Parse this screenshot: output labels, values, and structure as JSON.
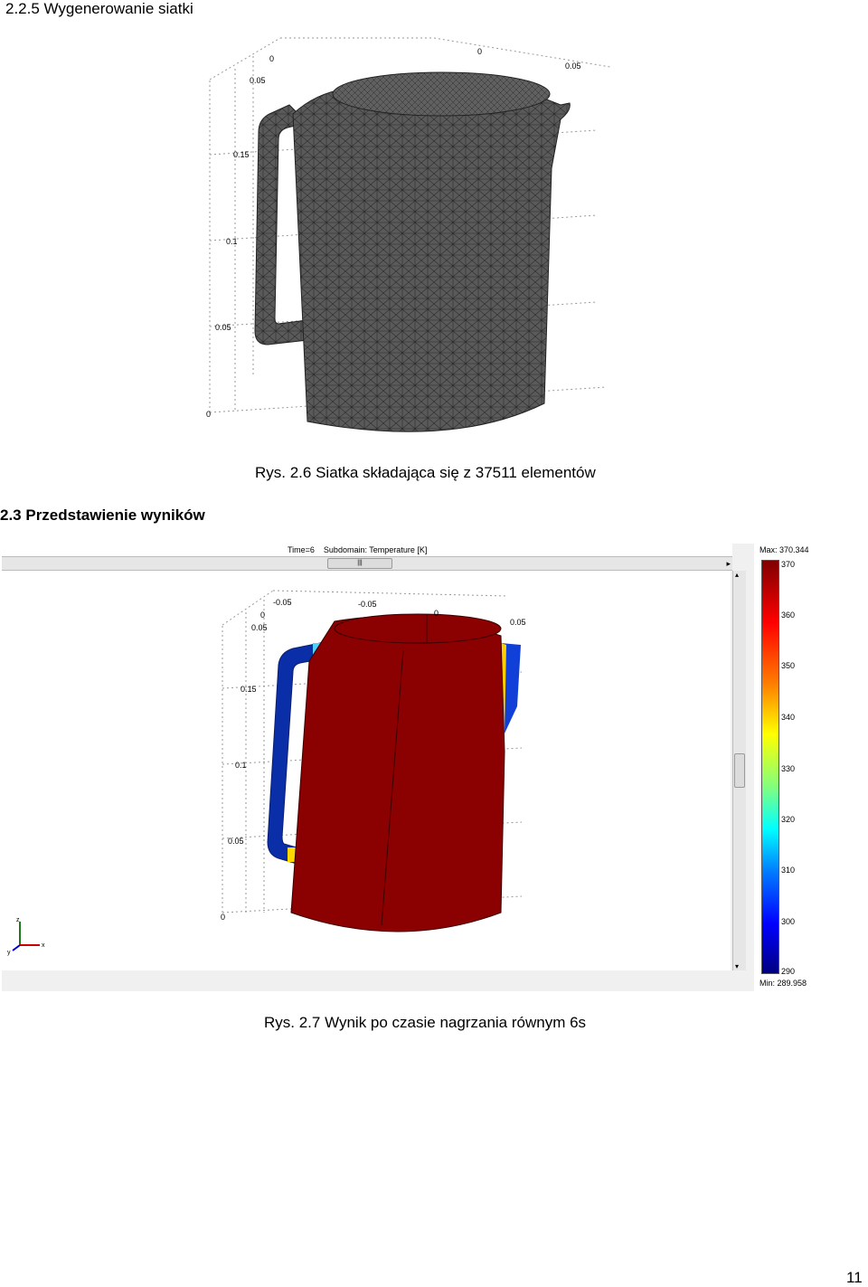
{
  "section_mesh": {
    "heading": "2.2.5 Wygenerowanie siatki"
  },
  "figure_mesh": {
    "caption": "Rys. 2.6 Siatka składająca się z 37511 elementów",
    "axis_ticks": {
      "z": [
        "0.05",
        "0.15",
        "0.1",
        "0.05",
        "0"
      ],
      "top_left": "0",
      "top_mid": "0",
      "top_right": "0.05"
    }
  },
  "section_results": {
    "heading": "2.3 Przedstawienie wyników"
  },
  "figure_result": {
    "caption": "Rys. 2.7 Wynik po czasie nagrzania równym 6s",
    "plot_title": "Time=6    Subdomain: Temperature [K]",
    "scroll_grip": "|||",
    "axis_ticks": {
      "top_x1": "-0.05",
      "top_x2": "-0.05",
      "top_y": "0",
      "top_z0": "0",
      "top_z1": "0.05",
      "top_right": "0.05",
      "z": [
        "0.15",
        "0.1",
        "0.05",
        "0"
      ]
    },
    "triad": {
      "x": "x",
      "y": "y",
      "z": "z"
    },
    "colorbar": {
      "max_label": "Max: 370.344",
      "min_label": "Min: 289.958",
      "ticks": [
        "370",
        "360",
        "350",
        "340",
        "330",
        "320",
        "310",
        "300",
        "290"
      ]
    }
  },
  "page_number": "11"
}
